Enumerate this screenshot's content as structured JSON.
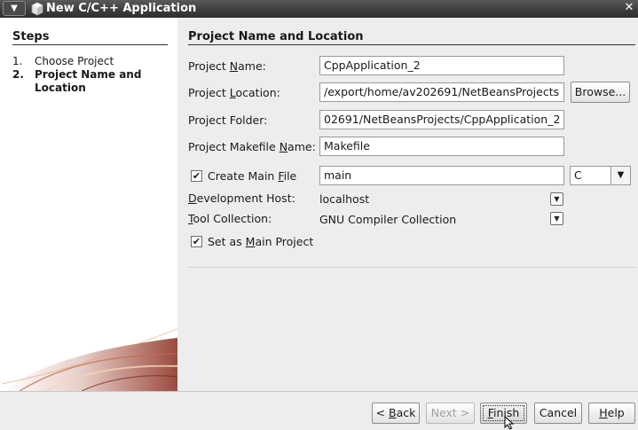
{
  "window": {
    "title": "New C/C++ Application",
    "menu_glyph": "▼",
    "close_glyph": "✕"
  },
  "steps": {
    "title": "Steps",
    "items": [
      {
        "num": "1.",
        "label": "Choose Project",
        "current": false
      },
      {
        "num": "2.",
        "label": "Project Name and Location",
        "current": true
      }
    ]
  },
  "section": {
    "title": "Project Name and Location"
  },
  "form": {
    "project_name": {
      "label_pre": "Project ",
      "label_mn": "N",
      "label_post": "ame:",
      "value": "CppApplication_2"
    },
    "project_location": {
      "label_pre": "Project ",
      "label_mn": "L",
      "label_post": "ocation:",
      "value": "/export/home/av202691/NetBeansProjects"
    },
    "browse_button": "Browse...",
    "project_folder": {
      "label": "Project Folder:",
      "value": "02691/NetBeansProjects/CppApplication_2"
    },
    "makefile_name": {
      "label_pre": "Project Makefile ",
      "label_mn": "N",
      "label_post": "ame:",
      "value": "Makefile"
    },
    "create_main": {
      "label_pre": "Create Main ",
      "label_mn": "F",
      "label_post": "ile",
      "checked": true,
      "value": "main",
      "language": "C"
    },
    "dev_host": {
      "label_mn": "D",
      "label_post": "evelopment Host:",
      "value": "localhost"
    },
    "tool_collection": {
      "label_mn": "T",
      "label_post": "ool Collection:",
      "value": "GNU Compiler Collection"
    },
    "set_main": {
      "label_pre": "Set as ",
      "label_mn": "M",
      "label_post": "ain Project",
      "checked": true
    }
  },
  "buttons": {
    "back": {
      "pre": "< ",
      "mn": "B",
      "post": "ack"
    },
    "next": "Next >",
    "finish": {
      "mn": "F",
      "post": "inish"
    },
    "cancel": "Cancel",
    "help": {
      "mn": "H",
      "post": "elp"
    }
  },
  "icons": {
    "check_glyph": "✔",
    "dropdown_glyph": "▼"
  }
}
